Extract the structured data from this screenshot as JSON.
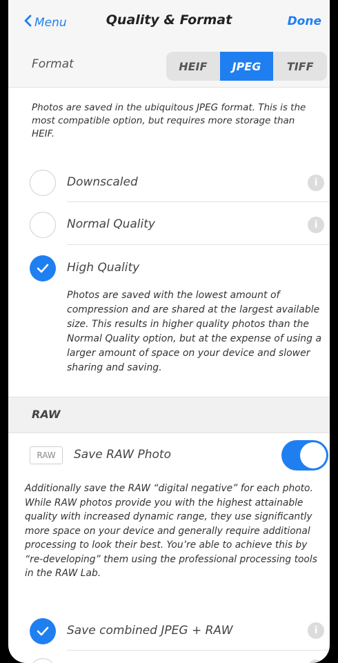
{
  "nav": {
    "back_label": "Menu",
    "title": "Quality & Format",
    "done_label": "Done"
  },
  "format": {
    "label": "Format",
    "options": [
      "HEIF",
      "JPEG",
      "TIFF"
    ],
    "selected": "JPEG",
    "description": "Photos are saved in the ubiquitous JPEG format. This is the most compatible option, but requires more storage than HEIF."
  },
  "quality": {
    "options": [
      {
        "label": "Downscaled",
        "checked": false
      },
      {
        "label": "Normal Quality",
        "checked": false
      },
      {
        "label": "High Quality",
        "checked": true
      }
    ],
    "high_quality_description": "Photos are saved with the lowest amount of compression and are shared at the largest available size. This results in higher quality photos than the Normal Quality option, but at the expense of using a larger amount of space on your device and slower sharing and saving."
  },
  "raw": {
    "section_label": "RAW",
    "badge": "RAW",
    "save_label": "Save RAW Photo",
    "save_enabled": true,
    "description": "Additionally save the RAW “digital negative” for each photo. While RAW photos provide you with the highest attainable quality with increased dynamic range, they use significantly more space on your device and generally require additional processing to look their best. You’re able to achieve this by “re-developing” them using the professional processing tools in the RAW Lab.",
    "combined_label": "Save combined JPEG + RAW",
    "combined_checked": true
  },
  "colors": {
    "accent": "#1f7ff0",
    "info_icon": "#dcdcdc"
  },
  "icons": {
    "back": "chevron-left-icon",
    "check": "checkmark-icon",
    "info": "info-icon"
  }
}
